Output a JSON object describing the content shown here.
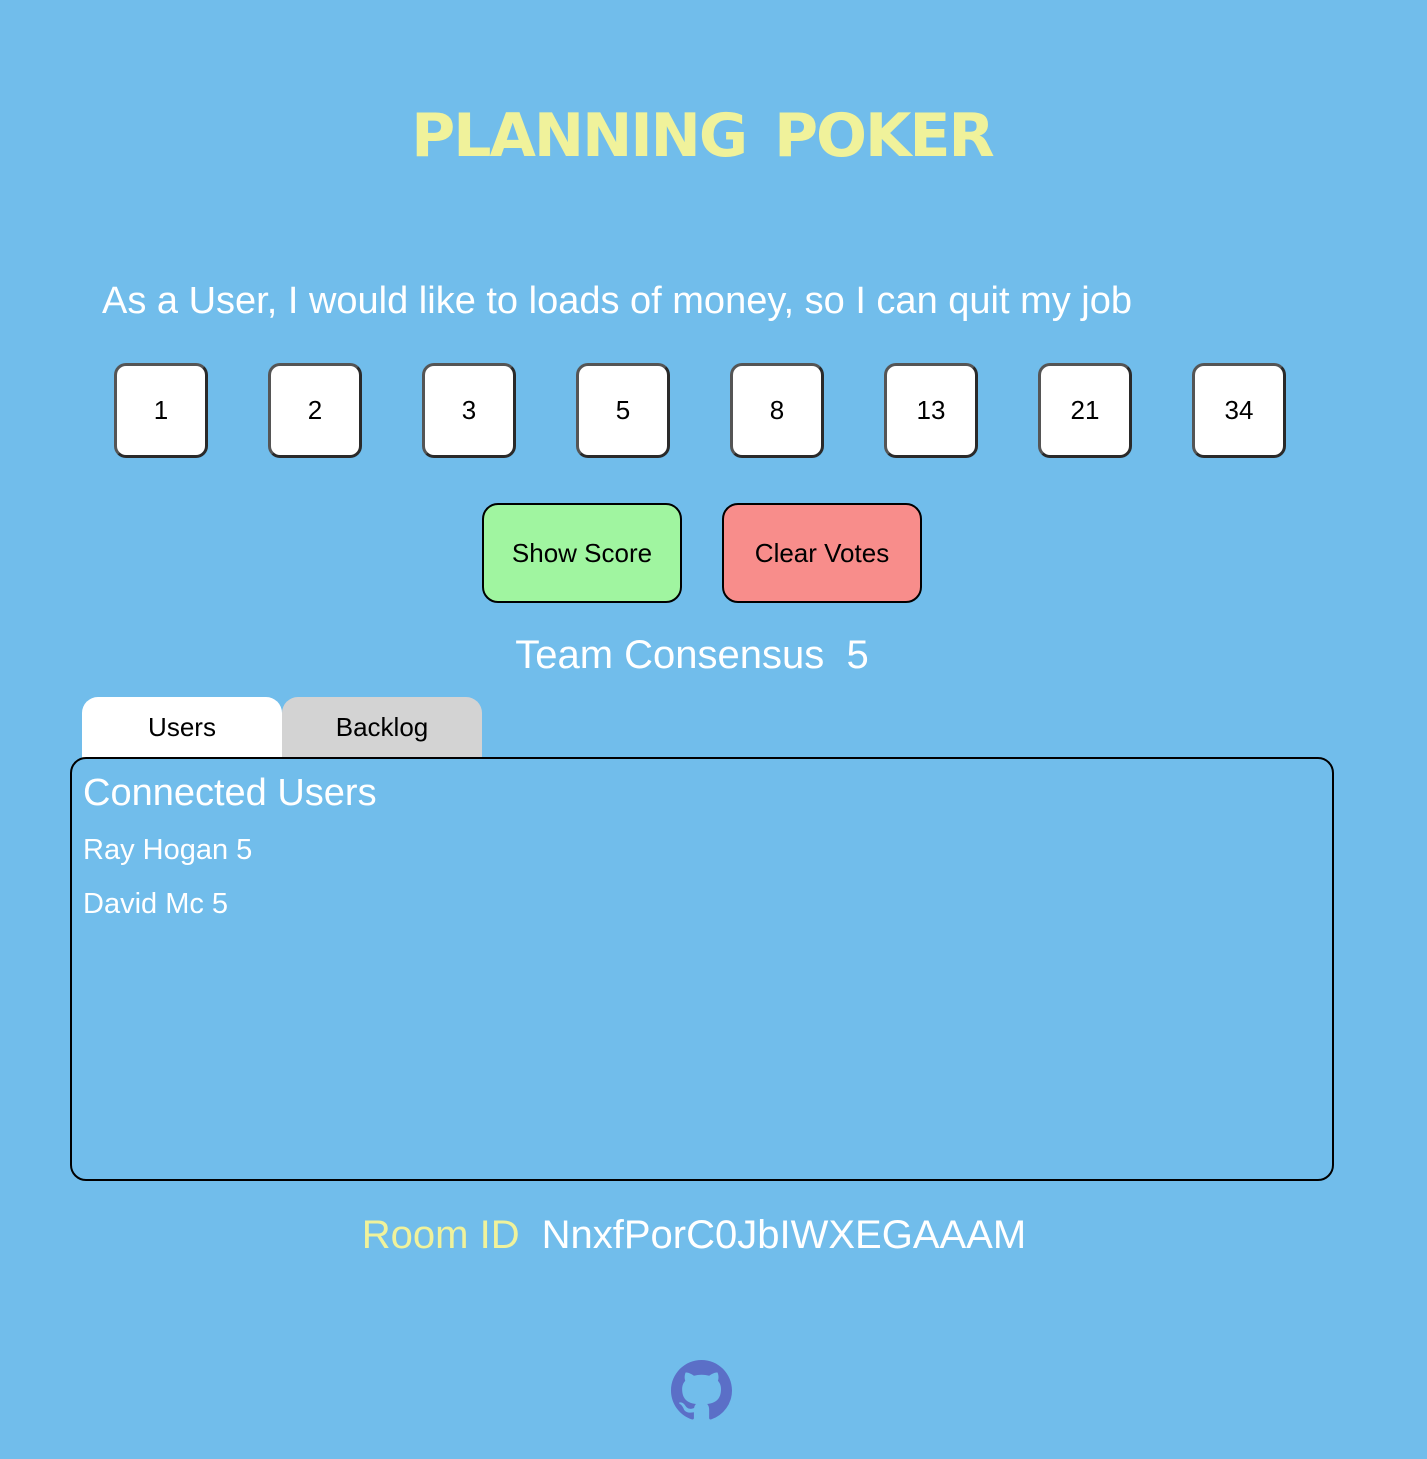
{
  "app": {
    "title": "Planning Poker"
  },
  "story": "As a User, I would like to loads of money, so I can quit my job",
  "cards": [
    "1",
    "2",
    "3",
    "5",
    "8",
    "13",
    "21",
    "34"
  ],
  "actions": {
    "show_score": "Show Score",
    "clear_votes": "Clear Votes"
  },
  "consensus": {
    "label": "Team Consensus",
    "value": "5"
  },
  "tabs": {
    "users": "Users",
    "backlog": "Backlog",
    "active": "Users"
  },
  "users_panel": {
    "heading": "Connected Users",
    "users": [
      "Ray Hogan 5",
      "David Mc 5"
    ]
  },
  "room": {
    "label": "Room ID",
    "id": "NnxfPorC0JbIWXEGAAAM"
  },
  "icons": {
    "footer": "github-icon"
  },
  "colors": {
    "background": "#71bdeb",
    "title": "#f0f29b",
    "show_score": "#a0f5a0",
    "clear_votes": "#f88d8b",
    "github": "#5b6fc7"
  }
}
